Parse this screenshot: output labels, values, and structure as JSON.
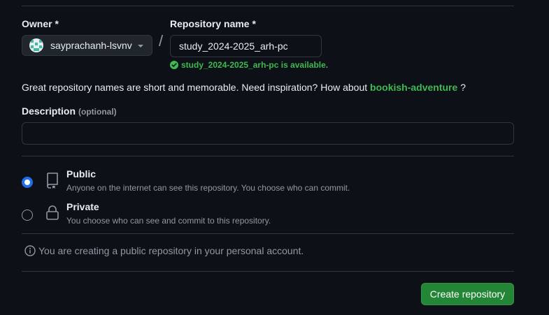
{
  "owner": {
    "label": "Owner *",
    "selected": "sayprachanh-lsvnv"
  },
  "repository": {
    "label": "Repository name *",
    "value": "study_2024-2025_arh-pc",
    "availability": "study_2024-2025_arh-pc is available."
  },
  "separator": "/",
  "hint": {
    "text": "Great repository names are short and memorable. Need inspiration? How about",
    "suggestion": "bookish-adventure",
    "end": "?"
  },
  "description": {
    "label": "Description",
    "optional": "(optional)",
    "value": ""
  },
  "visibility": {
    "public": {
      "title": "Public",
      "description": "Anyone on the internet can see this repository. You choose who can commit.",
      "selected": true
    },
    "private": {
      "title": "Private",
      "description": "You choose who can see and commit to this repository.",
      "selected": false
    }
  },
  "notice": "You are creating a public repository in your personal account.",
  "actions": {
    "create_label": "Create repository"
  },
  "colors": {
    "background": "#0d1117",
    "success": "#3fb950",
    "primary_button": "#238636",
    "radio_selected": "#1f6feb"
  }
}
